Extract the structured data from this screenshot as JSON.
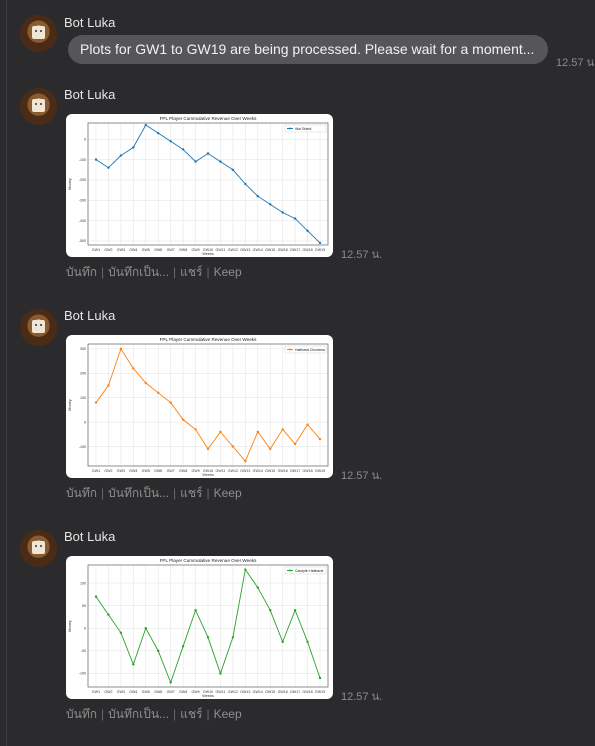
{
  "sender": "Bot Luka",
  "text_message": {
    "text": "Plots for GW1 to GW19 are being processed. Please wait for a moment...",
    "time": "12.57 น."
  },
  "actions": {
    "save": "บันทึก",
    "save_as": "บันทึกเป็น...",
    "share": "แชร์",
    "keep": "Keep"
  },
  "accent_colors": {
    "series1": "#1f77b4",
    "series2": "#ff7f0e",
    "series3": "#2ca02c"
  },
  "plots": [
    {
      "time": "12.57 น.",
      "chart_data": {
        "type": "line",
        "title": "FPL Player Cummulative Revenue Over Weeks",
        "xlabel": "Weeks",
        "ylabel": "Money",
        "categories": [
          "GW1",
          "GW2",
          "GW3",
          "GW4",
          "GW5",
          "GW6",
          "GW7",
          "GW8",
          "GW9",
          "GW10",
          "GW11",
          "GW12",
          "GW13",
          "GW14",
          "GW15",
          "GW16",
          "GW17",
          "GW18",
          "GW19"
        ],
        "series": [
          {
            "name": "Wai Siriarit",
            "color": "#1f77b4",
            "values": [
              100,
              60,
              120,
              160,
              270,
              230,
              190,
              150,
              90,
              130,
              90,
              50,
              -20,
              -80,
              -120,
              -160,
              -190,
              -250,
              -310
            ]
          }
        ],
        "ylim": [
          -320,
          280
        ],
        "yticks": [
          -300,
          -200,
          -100,
          0,
          100,
          200,
          300,
          400
        ],
        "ytick_labels": [
          "-500",
          "-400",
          "-300",
          "-200",
          "-100",
          "0",
          "100",
          "200"
        ],
        "legend": "top-right",
        "grid": true
      }
    },
    {
      "time": "12.57 น.",
      "chart_data": {
        "type": "line",
        "title": "FPL Player Cummulative Revenue Over Weeks",
        "xlabel": "Weeks",
        "ylabel": "Money",
        "categories": [
          "GW1",
          "GW2",
          "GW3",
          "GW4",
          "GW5",
          "GW6",
          "GW7",
          "GW8",
          "GW9",
          "GW10",
          "GW11",
          "GW12",
          "GW13",
          "GW14",
          "GW15",
          "GW16",
          "GW17",
          "GW18",
          "GW19"
        ],
        "series": [
          {
            "name": "Hattharat Chontana",
            "color": "#ff7f0e",
            "values": [
              80,
              150,
              300,
              220,
              160,
              120,
              80,
              10,
              -30,
              -110,
              -40,
              -100,
              -160,
              -40,
              -110,
              -30,
              -90,
              -10,
              -70
            ]
          }
        ],
        "ylim": [
          -180,
          320
        ],
        "yticks": [
          -100,
          0,
          100,
          200,
          300
        ],
        "ytick_labels": [
          "-100",
          "0",
          "100",
          "200",
          "300"
        ],
        "legend": "top-right",
        "grid": true
      }
    },
    {
      "time": "12.57 น.",
      "chart_data": {
        "type": "line",
        "title": "FPL Player Cummulative Revenue Over Weeks",
        "xlabel": "Weeks",
        "ylabel": "Money",
        "categories": [
          "GW1",
          "GW2",
          "GW3",
          "GW4",
          "GW5",
          "GW6",
          "GW7",
          "GW8",
          "GW9",
          "GW10",
          "GW11",
          "GW12",
          "GW13",
          "GW14",
          "GW15",
          "GW16",
          "GW17",
          "GW18",
          "GW19"
        ],
        "series": [
          {
            "name": "Candyfin Hattharat",
            "color": "#2ca02c",
            "values": [
              70,
              30,
              -10,
              -80,
              0,
              -50,
              -120,
              -40,
              40,
              -20,
              -100,
              -20,
              130,
              90,
              40,
              -30,
              40,
              -30,
              -110
            ]
          }
        ],
        "ylim": [
          -130,
          140
        ],
        "yticks": [
          -100,
          -50,
          0,
          50,
          100
        ],
        "ytick_labels": [
          "-100",
          "-50",
          "0",
          "50",
          "100"
        ],
        "legend": "top-right",
        "grid": true
      }
    }
  ]
}
